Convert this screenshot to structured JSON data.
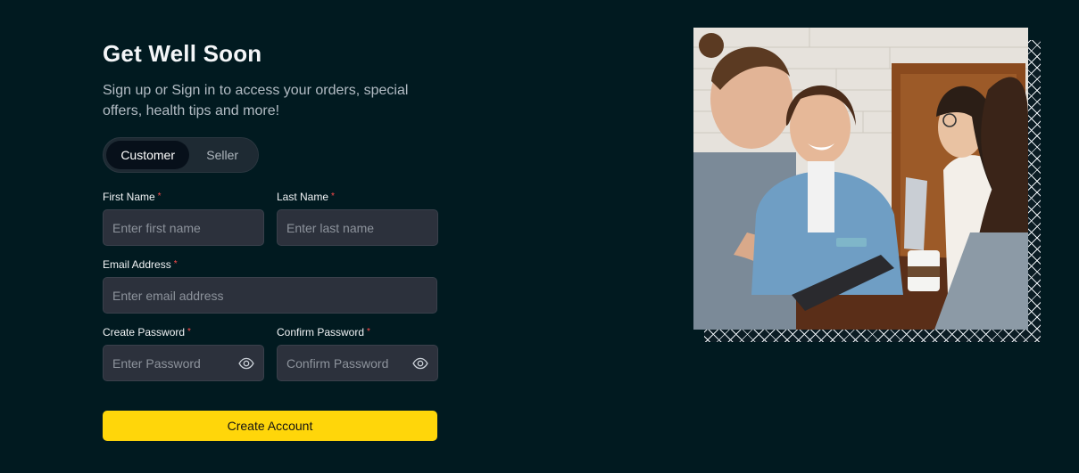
{
  "header": {
    "title": "Get Well Soon",
    "subtitle": "Sign up or Sign in to access your orders, special offers, health tips and more!"
  },
  "account_type": {
    "options": [
      "Customer",
      "Seller"
    ],
    "selected": "Customer"
  },
  "form": {
    "first_name": {
      "label": "First Name",
      "required_mark": "*",
      "placeholder": "Enter first name",
      "value": ""
    },
    "last_name": {
      "label": "Last Name",
      "required_mark": "*",
      "placeholder": "Enter last name",
      "value": ""
    },
    "email": {
      "label": "Email Address",
      "required_mark": "*",
      "placeholder": "Enter email address",
      "value": ""
    },
    "password": {
      "label": "Create Password",
      "required_mark": "*",
      "placeholder": "Enter Password",
      "value": "",
      "icon": "eye-icon"
    },
    "confirm_password": {
      "label": "Confirm Password",
      "required_mark": "*",
      "placeholder": "Confirm Password",
      "value": "",
      "icon": "eye-icon"
    },
    "submit_label": "Create Account"
  },
  "colors": {
    "background": "#011a20",
    "accent": "#ffd60a",
    "input_bg": "#2c313c",
    "required": "#ff4b4b"
  },
  "hero_image": {
    "subject": "group-of-friends-chatting-at-cafe-table"
  }
}
